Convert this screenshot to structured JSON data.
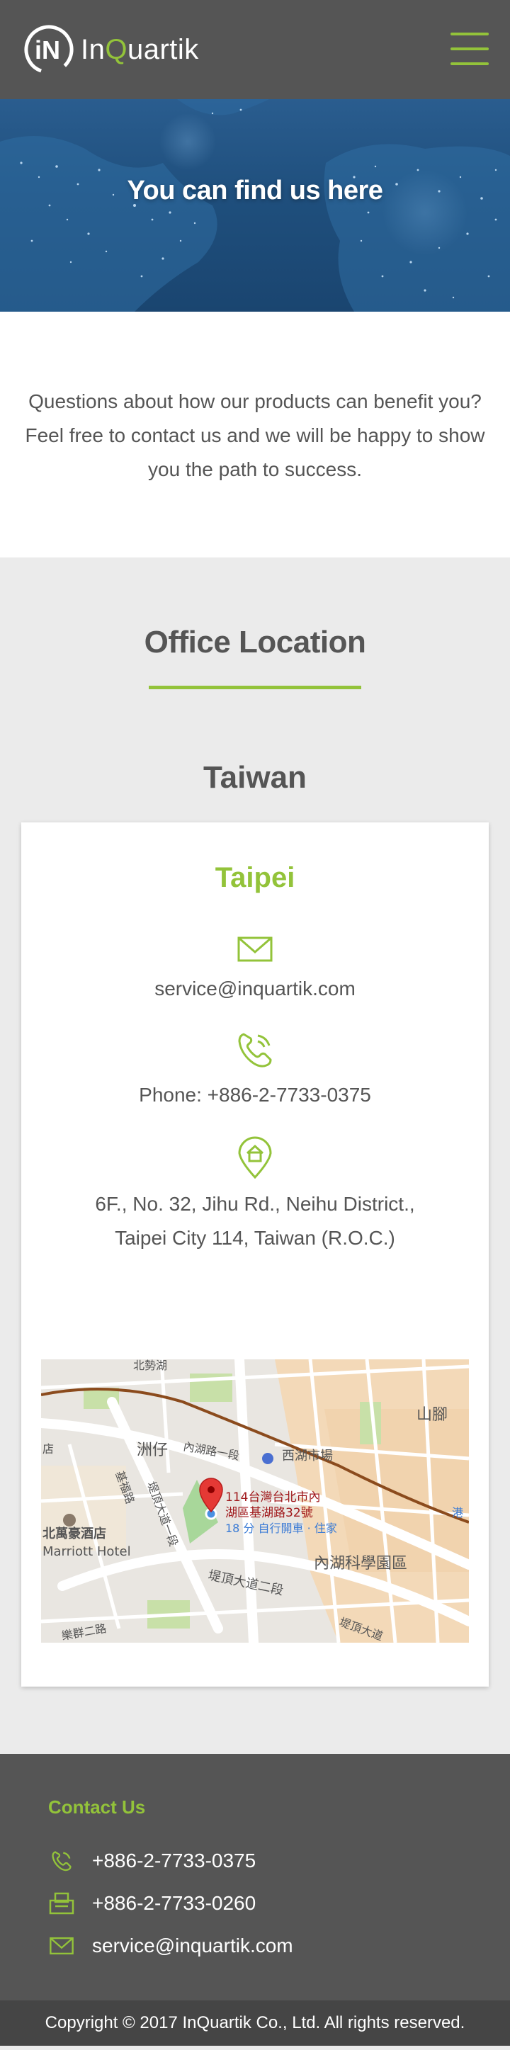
{
  "brand": {
    "name_prefix": "In",
    "name_q": "Q",
    "name_suffix": "uartik",
    "accent": "#93c33a",
    "header_bg": "#555555"
  },
  "header": {
    "menu_icon": "hamburger-menu-icon"
  },
  "hero": {
    "title": "You can find us here"
  },
  "intro": {
    "line1": "Questions about how our products can benefit you?",
    "line2": "Feel free to contact us and we will be happy to show",
    "line3": "you the path to success."
  },
  "office": {
    "heading": "Office Location",
    "country": "Taiwan",
    "city": "Taipei",
    "email": "service@inquartik.com",
    "phone": "Phone: +886-2-7733-0375",
    "address_line1": "6F., No. 32, Jihu Rd., Neihu District.,",
    "address_line2": "Taipei City 114, Taiwan (R.O.C.)",
    "map": {
      "pin_label_line1": "114台灣台北市內",
      "pin_label_line2": "湖區基湖路32號",
      "pin_label_line3": "18 分 自行開車 · 住家",
      "labels": {
        "zhouzi": "洲仔",
        "neihu_rd": "內湖路一段",
        "xihu_market": "西湖市場",
        "shanjiao": "山腳",
        "hotel_zh": "北萬豪酒店",
        "hotel_en": "Marriott Hotel",
        "dixia": "堤頂大道一段",
        "dixia2": "堤頂大道二段",
        "science_park": "內湖科學園區",
        "jifu": "基福路",
        "dian": "店",
        "gang": "港",
        "dixia3": "堤頂大道",
        "lequn": "樂群二路",
        "beigang": "北勢湖"
      }
    }
  },
  "footer": {
    "heading": "Contact Us",
    "phone": "+886-2-7733-0375",
    "fax": "+886-2-7733-0260",
    "email": "service@inquartik.com"
  },
  "copyright": "Copyright © 2017 InQuartik Co., Ltd. All rights reserved."
}
